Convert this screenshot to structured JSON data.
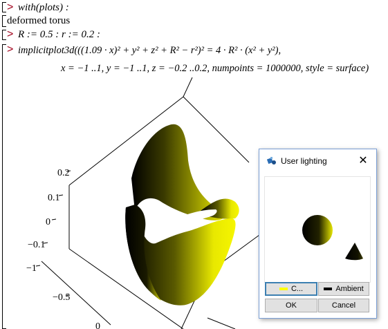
{
  "worksheet": {
    "prompt_symbol": ">",
    "cmd1": "with(plots) :",
    "output1": "deformed torus",
    "cmd2": "R := 0.5 : r := 0.2 :",
    "cmd3_line1": "implicitplot3d(((1.09 · x)² + y² + z² + R² − r²)² = 4 · R² · (x² + y²),",
    "cmd3_line2": "x = −1 ..1, y = −1 ..1, z = −0.2 ..0.2, numpoints = 1000000, style = surface)"
  },
  "plot": {
    "axis_labels": [
      "0.2",
      "0.1",
      "0",
      "−0.1",
      "−1",
      "−0.5",
      "0"
    ],
    "surface_color": "#f0f000"
  },
  "dialog": {
    "title": "User lighting",
    "close_glyph": "✕",
    "color_button_label": "C...",
    "ambient_button_label": "Ambient",
    "ok_label": "OK",
    "cancel_label": "Cancel",
    "light_color": "#ffff00",
    "ambient_color": "#000000",
    "icon": "lighting-app-icon"
  }
}
